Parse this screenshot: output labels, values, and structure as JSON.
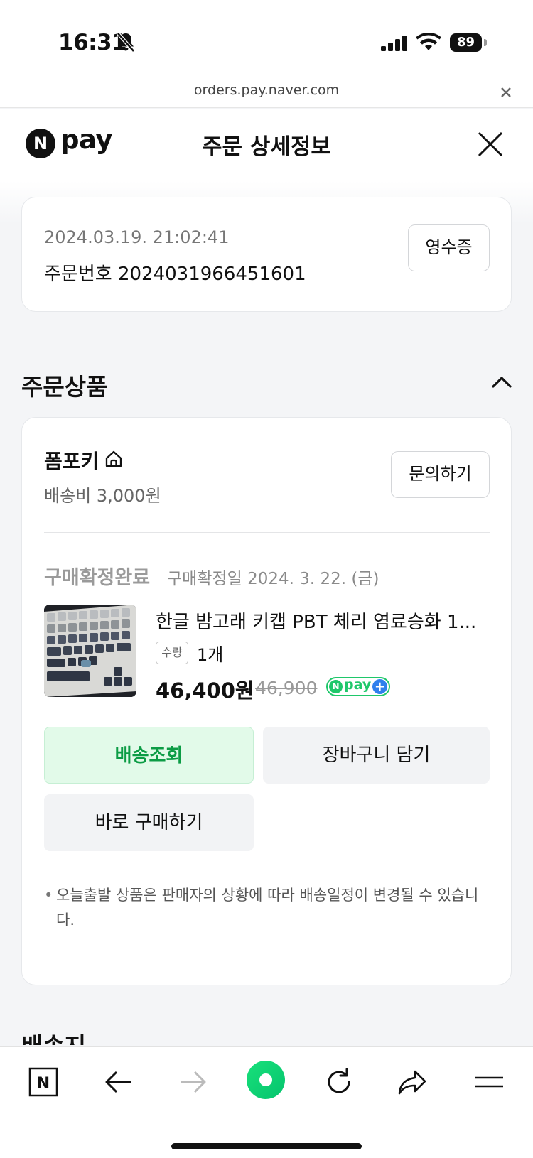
{
  "status_bar": {
    "time": "16:31",
    "battery": "89"
  },
  "browser": {
    "url": "orders.pay.naver.com"
  },
  "header": {
    "logo_letter": "N",
    "logo_text": "pay",
    "title": "주문 상세정보"
  },
  "order": {
    "date": "2024.03.19. 21:02:41",
    "order_number": "주문번호 2024031966451601",
    "receipt_label": "영수증"
  },
  "section": {
    "title": "주문상품",
    "next_title": "배송지"
  },
  "seller": {
    "name": "폼포키",
    "shipping_fee": "배송비 3,000원",
    "inquiry_label": "문의하기"
  },
  "product": {
    "status": "구매확정완료",
    "confirm_date": "구매확정일 2024. 3. 22. (금)",
    "title": "한글 밤고래 키캡 PBT 체리 염료승화 1...",
    "qty_label": "수량",
    "qty_value": "1개",
    "price": "46,400원",
    "original_price": "46,900",
    "badge_letter": "N",
    "badge_text": "pay",
    "badge_plus": "+"
  },
  "actions": {
    "track": "배송조회",
    "cart": "장바구니 담기",
    "buy": "바로 구매하기"
  },
  "notice": {
    "bullet": "•",
    "text": "오늘출발 상품은 판매자의 상황에 따라 배송일정이 변경될 수 있습니다."
  },
  "toolbar": {
    "naver_letter": "N"
  },
  "colors": {
    "accent_green": "#0c9c45",
    "track_bg": "#e2fae9",
    "npay_green": "#1fc76a",
    "plus_blue": "#2f80ed",
    "page_bg": "#f4f5f7"
  },
  "icons": [
    "bell-slash-icon",
    "signal-icon",
    "wifi-icon",
    "battery-icon",
    "close-icon",
    "home-icon",
    "chevron-up-icon",
    "naver-home-icon",
    "back-arrow-icon",
    "forward-arrow-icon",
    "green-dot-icon",
    "reload-icon",
    "share-icon",
    "menu-icon"
  ]
}
